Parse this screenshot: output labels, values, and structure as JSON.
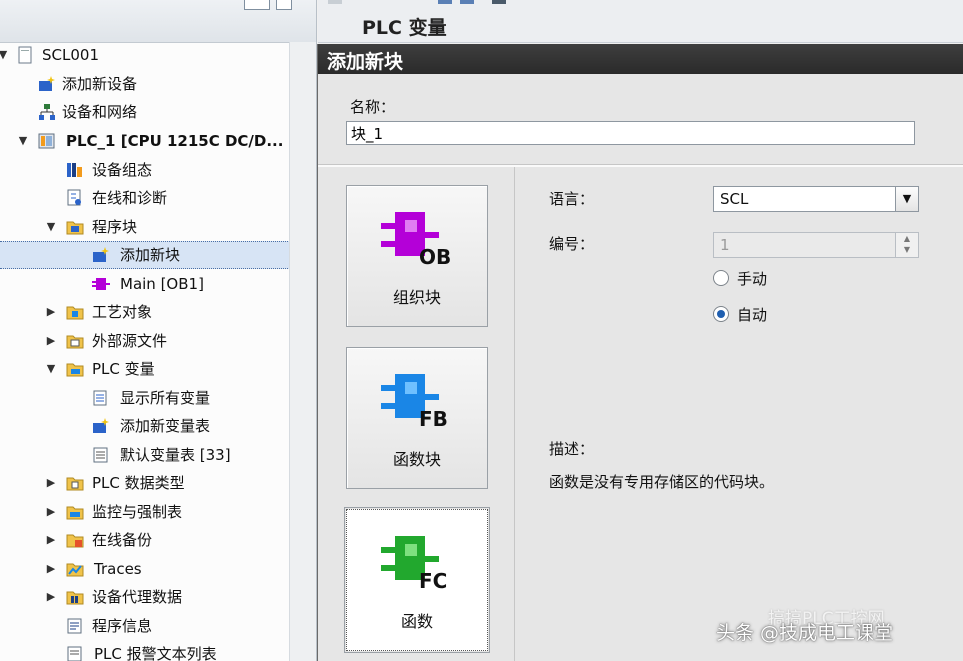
{
  "tree": {
    "items": [
      {
        "label": "SCL001",
        "icon": "project-icon"
      },
      {
        "label": "添加新设备",
        "icon": "add-device-icon"
      },
      {
        "label": "设备和网络",
        "icon": "network-icon"
      },
      {
        "label": "PLC_1 [CPU 1215C DC/D...",
        "icon": "plc-icon"
      },
      {
        "label": "设备组态",
        "icon": "device-config-icon"
      },
      {
        "label": "在线和诊断",
        "icon": "online-diagnostics-icon"
      },
      {
        "label": "程序块",
        "icon": "folder-program-blocks-icon"
      },
      {
        "label": "添加新块",
        "icon": "add-block-icon"
      },
      {
        "label": "Main [OB1]",
        "icon": "ob-block-icon"
      },
      {
        "label": "工艺对象",
        "icon": "folder-technology-icon"
      },
      {
        "label": "外部源文件",
        "icon": "folder-external-source-icon"
      },
      {
        "label": "PLC 变量",
        "icon": "folder-plc-tags-icon"
      },
      {
        "label": "显示所有变量",
        "icon": "show-all-tags-icon"
      },
      {
        "label": "添加新变量表",
        "icon": "add-tag-table-icon"
      },
      {
        "label": "默认变量表 [33]",
        "icon": "tag-table-icon"
      },
      {
        "label": "PLC 数据类型",
        "icon": "folder-data-types-icon"
      },
      {
        "label": "监控与强制表",
        "icon": "folder-watch-force-icon"
      },
      {
        "label": "在线备份",
        "icon": "folder-online-backup-icon"
      },
      {
        "label": "Traces",
        "icon": "folder-traces-icon"
      },
      {
        "label": "设备代理数据",
        "icon": "folder-proxy-data-icon"
      },
      {
        "label": "程序信息",
        "icon": "program-info-icon"
      },
      {
        "label": "PLC 报警文本列表",
        "icon": "alarm-text-icon"
      }
    ]
  },
  "editor": {
    "title": "PLC 变量"
  },
  "dialog": {
    "title": "添加新块",
    "name_label": "名称：",
    "name_value": "块_1",
    "block_types": [
      {
        "label": "组织块",
        "tag": "OB",
        "color": "#b400d8"
      },
      {
        "label": "函数块",
        "tag": "FB",
        "color": "#1a86e6"
      },
      {
        "label": "函数",
        "tag": "FC",
        "color": "#22a82e"
      }
    ],
    "language_label": "语言：",
    "language_value": "SCL",
    "number_label": "编号：",
    "number_value": "1",
    "manual_label": "手动",
    "auto_label": "自动",
    "description_label": "描述：",
    "description_text": "函数是没有专用存储区的代码块。"
  },
  "watermark": {
    "top": "搞搞PLC工控网",
    "bottom": "头条 @技成电工课堂"
  }
}
